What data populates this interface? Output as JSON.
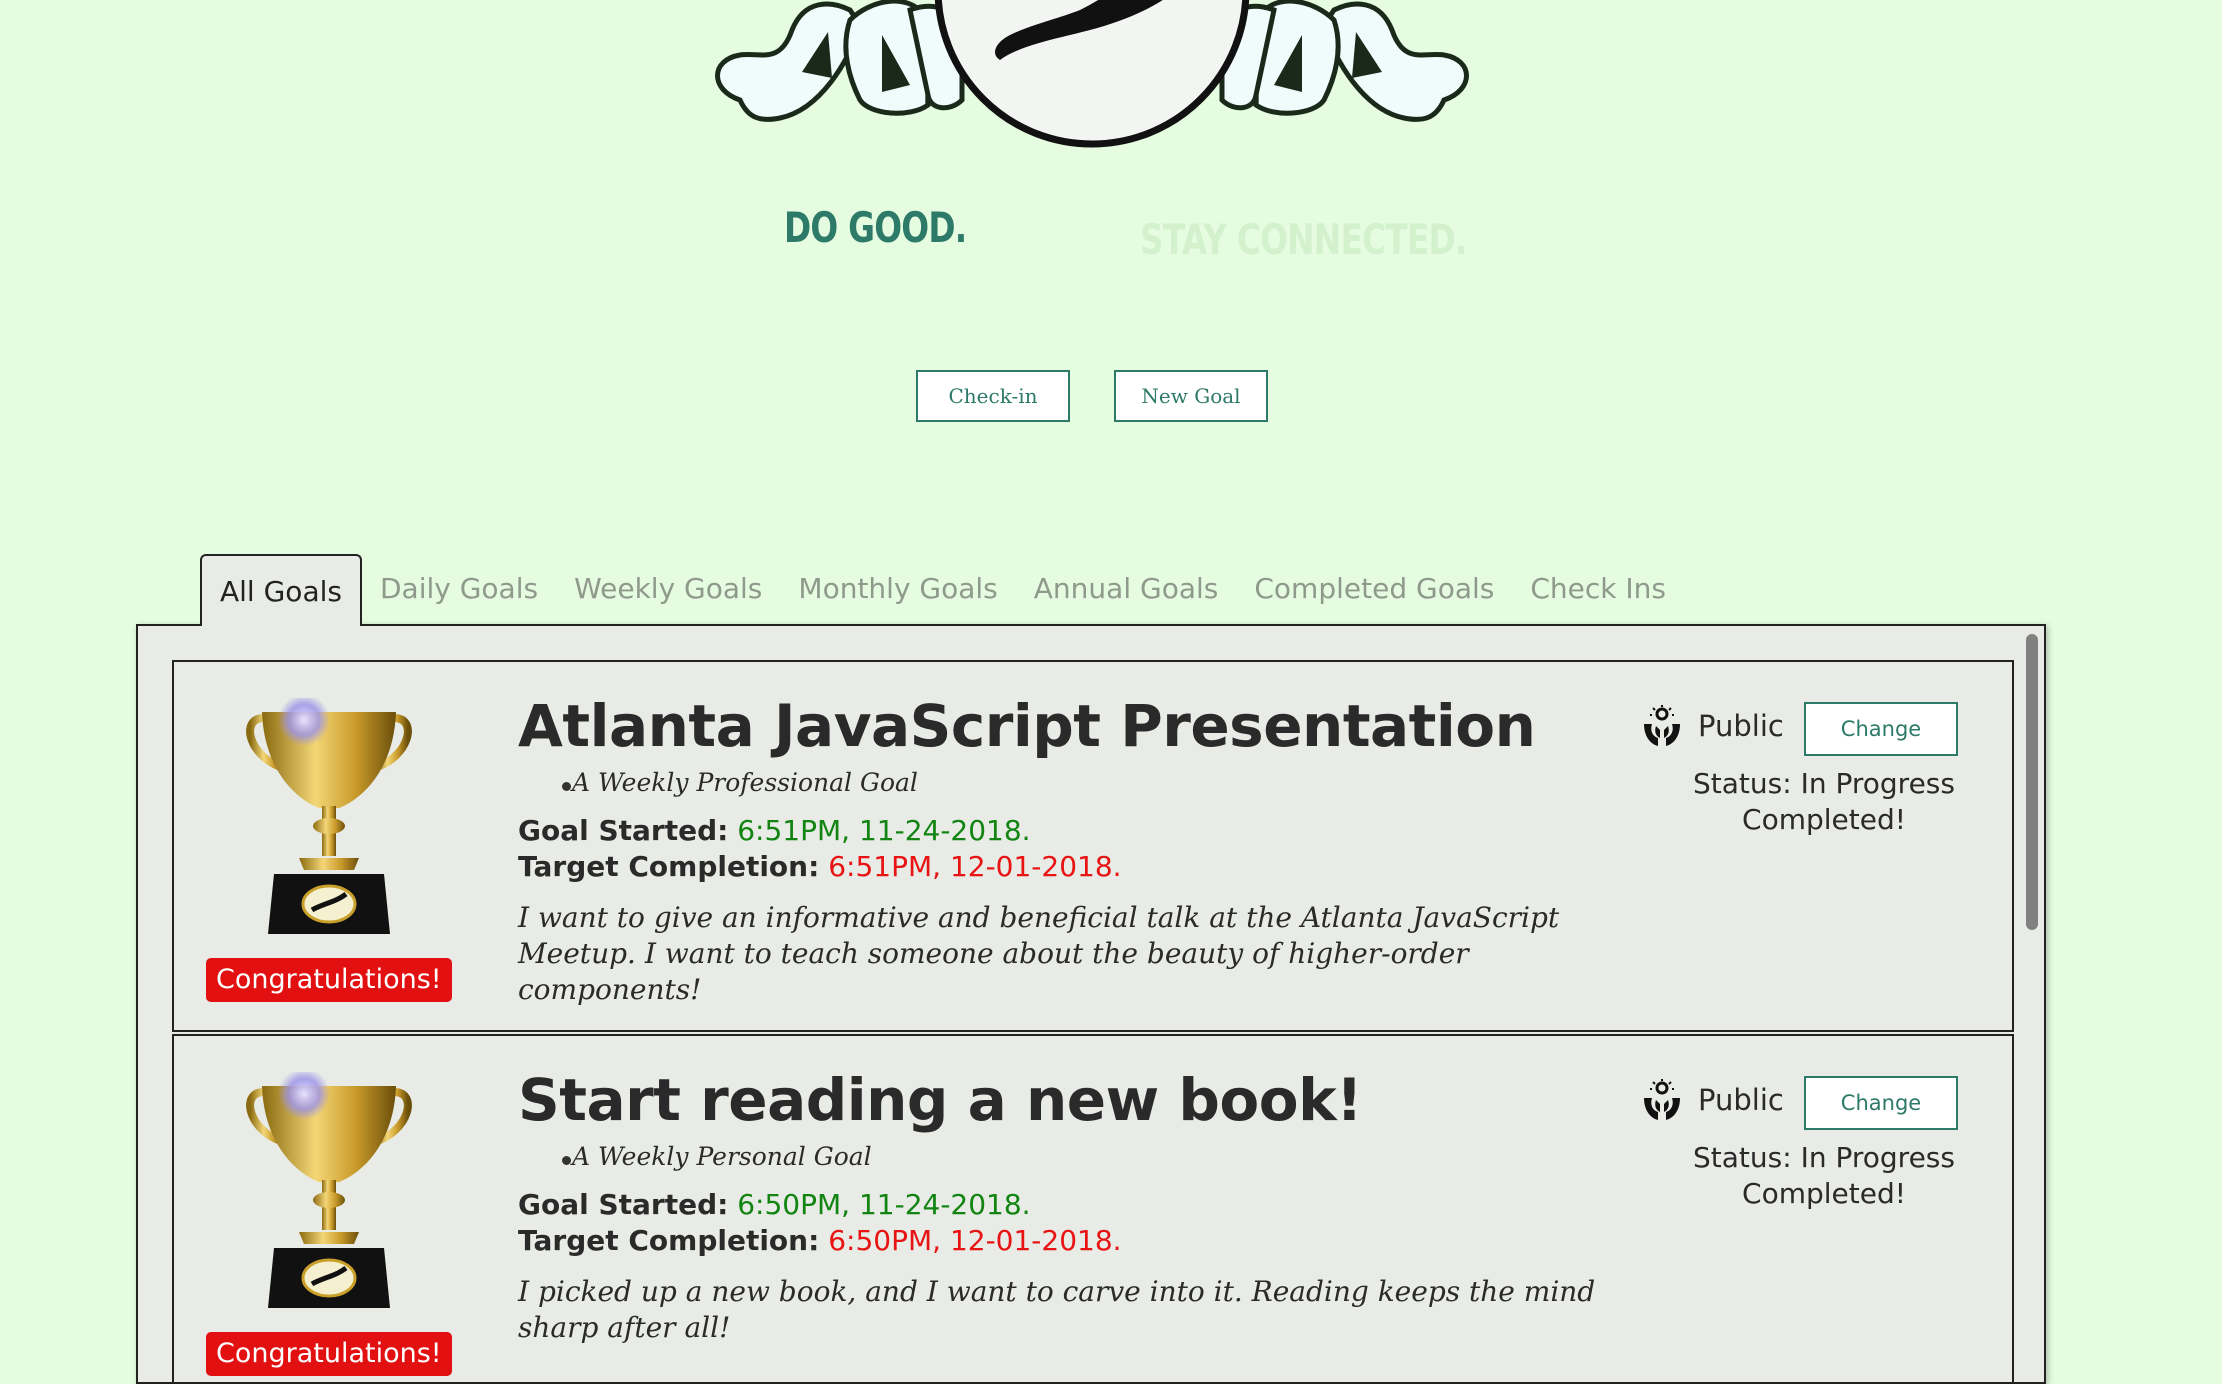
{
  "header": {
    "tagline_1": "DO GOOD.",
    "tagline_2": "STAY CONNECTED."
  },
  "actions": {
    "checkin_label": "Check-in",
    "new_goal_label": "New Goal"
  },
  "tabs": [
    {
      "label": "All Goals",
      "active": true
    },
    {
      "label": "Daily Goals",
      "active": false
    },
    {
      "label": "Weekly Goals",
      "active": false
    },
    {
      "label": "Monthly Goals",
      "active": false
    },
    {
      "label": "Annual Goals",
      "active": false
    },
    {
      "label": "Completed Goals",
      "active": false
    },
    {
      "label": "Check Ins",
      "active": false
    }
  ],
  "goals": [
    {
      "title": "Atlanta JavaScript Presentation",
      "type": "A Weekly Professional Goal",
      "started_label": "Goal Started:",
      "started_value": "6:51PM, 11-24-2018.",
      "target_label": "Target Completion:",
      "target_value": "6:51PM, 12-01-2018.",
      "description": "I want to give an informative and beneficial talk at the Atlanta JavaScript Meetup. I want to teach someone about the beauty of higher-order components!",
      "privacy": "Public",
      "change_label": "Change",
      "status": "Status: In Progress",
      "completed": "Completed!",
      "badge": "Congratulations!"
    },
    {
      "title": "Start reading a new book!",
      "type": "A Weekly Personal Goal",
      "started_label": "Goal Started:",
      "started_value": "6:50PM, 11-24-2018.",
      "target_label": "Target Completion:",
      "target_value": "6:50PM, 12-01-2018.",
      "description": "I picked up a new book, and I want to carve into it. Reading keeps the mind sharp after all!",
      "privacy": "Public",
      "change_label": "Change",
      "status": "Status: In Progress",
      "completed": "Completed!",
      "badge": "Congratulations!"
    }
  ],
  "colors": {
    "background": "#e5fce0",
    "accent": "#2c7a67",
    "start_date": "#128412",
    "target_date": "#e81313",
    "badge": "#e21010"
  },
  "icons": {
    "logo": "hand-in-circle-logo",
    "trophy": "trophy-icon",
    "privacy": "community-hands-icon"
  }
}
